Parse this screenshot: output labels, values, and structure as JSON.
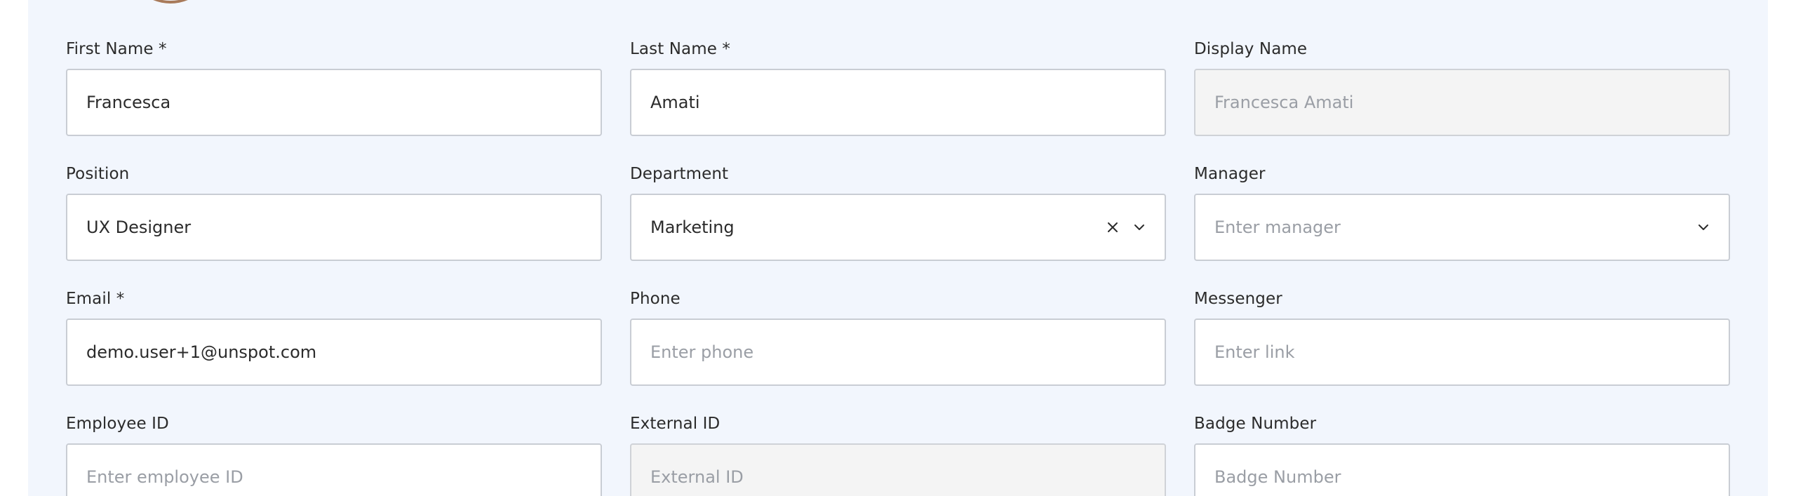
{
  "form": {
    "first_name": {
      "label": "First Name *",
      "value": "Francesca"
    },
    "last_name": {
      "label": "Last Name *",
      "value": "Amati"
    },
    "display_name": {
      "label": "Display Name",
      "placeholder": "Francesca Amati"
    },
    "position": {
      "label": "Position",
      "value": "UX Designer"
    },
    "department": {
      "label": "Department",
      "value": "Marketing"
    },
    "manager": {
      "label": "Manager",
      "placeholder": "Enter manager"
    },
    "email": {
      "label": "Email *",
      "value": "demo.user+1@unspot.com"
    },
    "phone": {
      "label": "Phone",
      "placeholder": "Enter phone"
    },
    "messenger": {
      "label": "Messenger",
      "placeholder": "Enter link"
    },
    "employee_id": {
      "label": "Employee ID",
      "placeholder": "Enter employee ID"
    },
    "external_id": {
      "label": "External ID",
      "placeholder": "External ID"
    },
    "badge_number": {
      "label": "Badge Number",
      "placeholder": "Badge Number"
    }
  },
  "icons": {
    "clear": "close-icon",
    "dropdown": "chevron-down-icon"
  },
  "colors": {
    "panel_bg": "#f2f6fd",
    "input_border": "#c9cdd4",
    "disabled_bg": "#f4f4f4",
    "placeholder": "#9a9ea5"
  }
}
